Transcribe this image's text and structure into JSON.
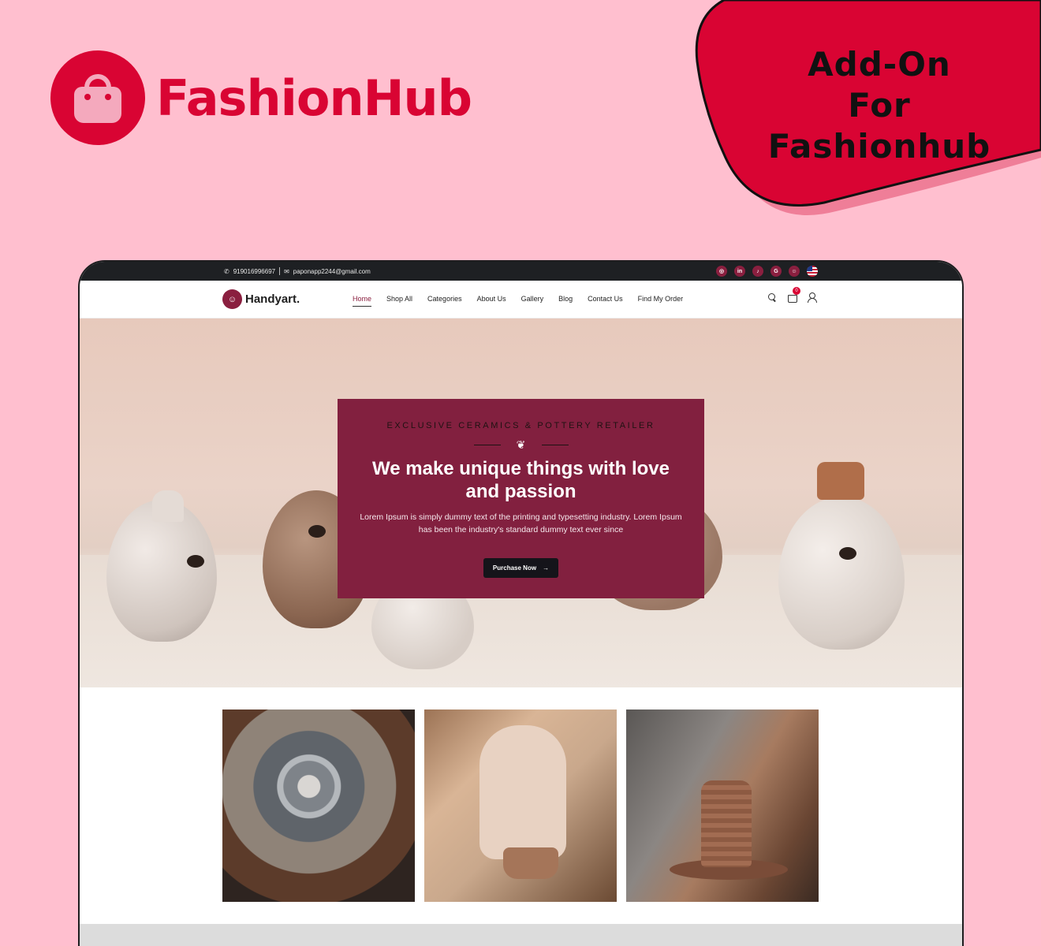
{
  "brand": {
    "name": "FashionHub",
    "icon": "shopping-bag-icon",
    "color": "#d90433"
  },
  "badge": {
    "line1": "Add-On",
    "line2": "For Fashionhub",
    "color": "#d90433"
  },
  "topbar": {
    "phone": "919016996697",
    "email": "paponapp2244@gmail.com",
    "socials": [
      {
        "name": "instagram-icon",
        "glyph": "◎"
      },
      {
        "name": "linkedin-icon",
        "glyph": "in"
      },
      {
        "name": "tiktok-icon",
        "glyph": "♪"
      },
      {
        "name": "google-icon",
        "glyph": "G"
      },
      {
        "name": "snapchat-icon",
        "glyph": "☺"
      }
    ]
  },
  "site": {
    "logo_text": "Handyart.",
    "accent": "#82203f",
    "nav": [
      "Home",
      "Shop All",
      "Categories",
      "About Us",
      "Gallery",
      "Blog",
      "Contact Us",
      "Find My Order"
    ],
    "active_nav": "Home",
    "cart_count": "0"
  },
  "hero": {
    "eyebrow": "EXCLUSIVE CERAMICS & POTTERY RETAILER",
    "title": "We make unique things with love and passion",
    "description": "Lorem Ipsum is simply dummy text of the printing and typesetting industry. Lorem Ipsum has been the industry's standard dummy text ever since",
    "cta": "Purchase Now"
  }
}
